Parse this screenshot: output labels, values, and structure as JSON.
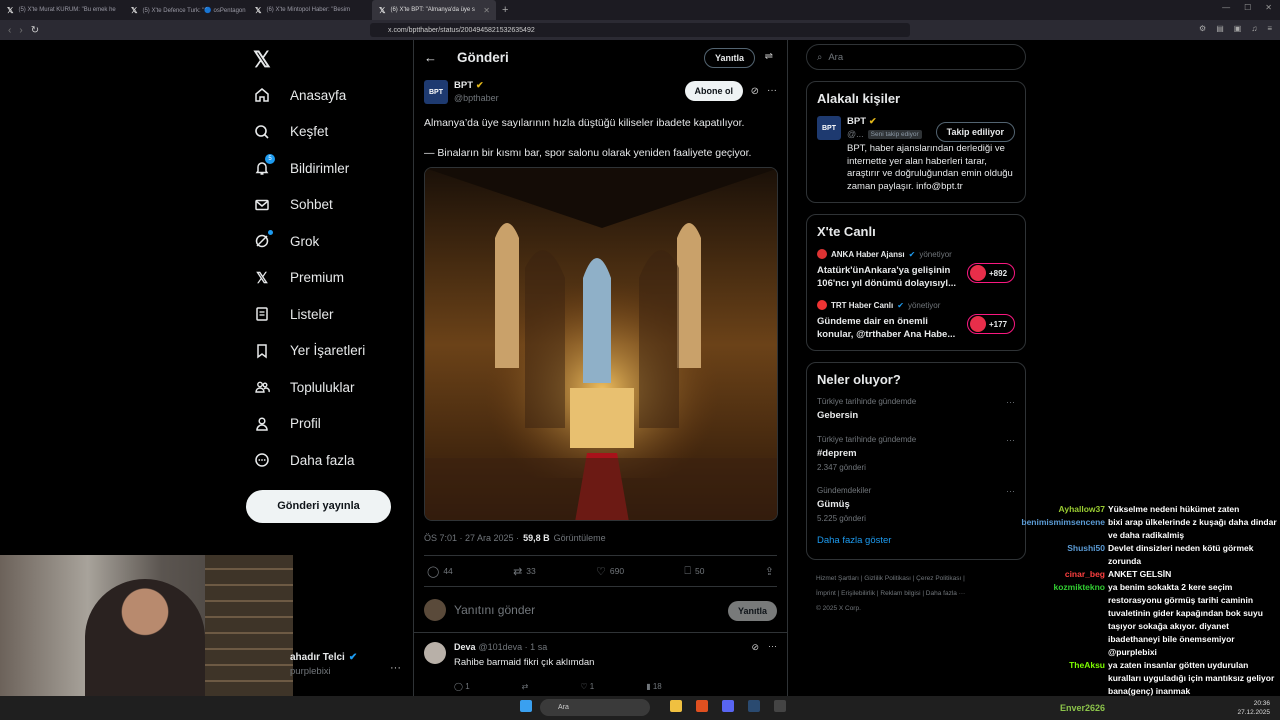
{
  "browser": {
    "tabs": [
      {
        "label": "(5) X'te Murat KURUM: \"Bu emek he"
      },
      {
        "label": "(5) X'te Defence Turk: \"🔵 osPentagon"
      },
      {
        "label": "(6) X'te Mintopol Haber: \"Besim"
      },
      {
        "label": "(6) X'te BPT: \"Almanya'da üye s"
      }
    ],
    "url": "x.com/bptthaber/status/2004945821532635492"
  },
  "sidebar": {
    "items": [
      {
        "label": "Anasayfa"
      },
      {
        "label": "Keşfet"
      },
      {
        "label": "Bildirimler",
        "badge": "5"
      },
      {
        "label": "Sohbet"
      },
      {
        "label": "Grok"
      },
      {
        "label": "Premium"
      },
      {
        "label": "Listeler"
      },
      {
        "label": "Yer İşaretleri"
      },
      {
        "label": "Topluluklar"
      },
      {
        "label": "Profil"
      },
      {
        "label": "Daha fazla"
      }
    ],
    "post_button": "Gönderi yayınla",
    "profile_name": "ahadır Telci",
    "profile_handle": "purplebixi"
  },
  "main": {
    "title": "Gönderi",
    "reply_top": "Yanıtla",
    "tweet": {
      "name": "BPT",
      "handle": "@bpthaber",
      "avatar_text": "BPT",
      "subscribe": "Abone ol",
      "line1": "Almanya’da üye sayılarının hızla düştüğü kiliseler ibadete kapatılıyor.",
      "line2": "— Binaların bir kısmı bar, spor salonu olarak yeniden faaliyete geçiyor.",
      "time": "ÖS 7:01 · 27 Ara 2025 ·",
      "views": "59,8 B",
      "views_label": "Görüntüleme",
      "stats": {
        "replies": "44",
        "retweets": "33",
        "likes": "690",
        "bookmarks": "50"
      }
    },
    "reply_placeholder": "Yanıtını gönder",
    "reply_button": "Yanıtla",
    "comment": {
      "name": "Deva",
      "handle": "@101deva · 1 sa",
      "text": "Rahibe barmaid fikri çık aklımdan",
      "stats": {
        "replies": "1",
        "likes": "1",
        "views": "18"
      }
    }
  },
  "right": {
    "search_placeholder": "Ara",
    "related": {
      "title": "Alakalı kişiler",
      "name": "BPT",
      "handle": "@...",
      "follows_you": "Seni takip ediyor",
      "button": "Takip ediliyor",
      "bio": "BPT, haber ajanslarından derlediği ve internette yer alan haberleri tarar, araştırır ve doğruluğundan emin olduğu zaman paylaşır. info@bpt.tr"
    },
    "live": {
      "title": "X'te Canlı",
      "items": [
        {
          "host": "ANKA Haber Ajansı",
          "role": "yönetiyor",
          "title": "Atatürk'ünAnkara'ya gelişinin 106'ncı yıl dönümü dolayısıyl...",
          "count": "+892"
        },
        {
          "host": "TRT Haber Canlı",
          "role": "yönetiyor",
          "title": "Gündeme dair en önemli konular, @trthaber Ana Habe...",
          "count": "+177"
        }
      ]
    },
    "trends": {
      "title": "Neler oluyor?",
      "items": [
        {
          "cat": "Türkiye tarihinde gündemde",
          "name": "Gebersin",
          "count": ""
        },
        {
          "cat": "Türkiye tarihinde gündemde",
          "name": "#deprem",
          "count": "2.347 gönderi"
        },
        {
          "cat": "Gündemdekiler",
          "name": "Gümüş",
          "count": "5.225 gönderi"
        }
      ],
      "show_more": "Daha fazla göster"
    },
    "footer": {
      "line1": "Hizmet Şartları  |  Gizlilik Politikası  |  Çerez Politikası  |",
      "line2": "İmprint  |  Erişilebilirlik  |  Reklam bilgisi  |  Daha fazla ···",
      "line3": "© 2025 X Corp."
    }
  },
  "chat": [
    {
      "user": "Ayhallow37",
      "color": "#9acd32",
      "text": "Yükselme nedeni hükümet zaten"
    },
    {
      "user": "benimismimsencene",
      "color": "#5b9bd5",
      "text": "bixi arap ülkelerinde z kuşağı daha dindar ve daha radikalmiş"
    },
    {
      "user": "Shushi50",
      "color": "#5b9bd5",
      "text": "Devlet dinsizleri neden kötü görmek zorunda"
    },
    {
      "user": "cinar_beg",
      "color": "#ff4040",
      "text": "ANKET GELSİN"
    },
    {
      "user": "kozmiktekno",
      "color": "#32cd32",
      "text": "ya benim sokakta 2 kere seçim restorasyonu görmüş tarihi caminin tuvaletinin gider kapağından bok suyu taşıyor sokağa akıyor. diyanet ibadethaneyi bile önemsemiyor @purplebixi"
    },
    {
      "user": "TheAksu",
      "color": "#7cfc00",
      "text": "ya zaten insanlar götten uydurulan kuralları uyguladığı için mantıksız geliyor bana(genç) inanmak"
    }
  ],
  "chat_bottom_user": "Enver2626",
  "taskbar": {
    "search": "Ara",
    "time": "20:36",
    "date": "27.12.2025"
  }
}
